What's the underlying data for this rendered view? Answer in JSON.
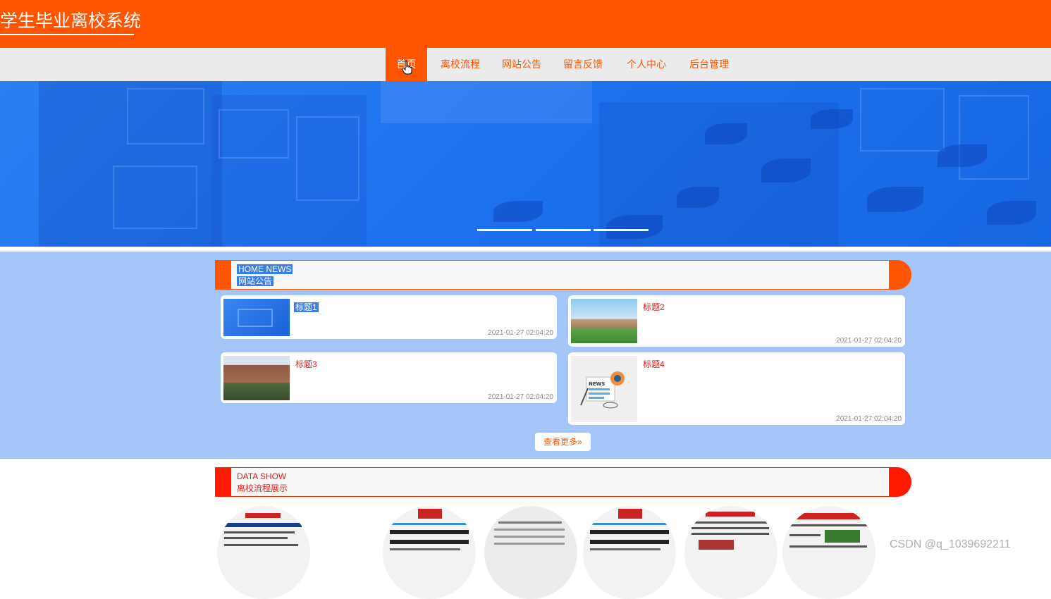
{
  "header": {
    "title": "学生毕业离校系统"
  },
  "nav": {
    "items": [
      {
        "label": "首页",
        "active": true
      },
      {
        "label": "离校流程"
      },
      {
        "label": "网站公告"
      },
      {
        "label": "留言反馈"
      },
      {
        "label": "个人中心"
      },
      {
        "label": "后台管理"
      }
    ]
  },
  "news": {
    "heading_en": "HOME NEWS",
    "heading_cn": "网站公告",
    "cards": [
      {
        "title": "标题1",
        "time": "2021-01-27 02:04:20"
      },
      {
        "title": "标题2",
        "time": "2021-01-27 02:04:20"
      },
      {
        "title": "标题3",
        "time": "2021-01-27 02:04:20"
      },
      {
        "title": "标题4",
        "time": "2021-01-27 02:04:20"
      }
    ],
    "more_label": "查看更多»"
  },
  "data_show": {
    "heading_en": "DATA SHOW",
    "heading_cn": "离校流程展示"
  },
  "watermark": "CSDN @q_1039692211",
  "colors": {
    "accent": "#ff5500",
    "banner": "#1e72ef",
    "news_bg": "#a5c4f7",
    "data_accent": "#ff1a00"
  }
}
